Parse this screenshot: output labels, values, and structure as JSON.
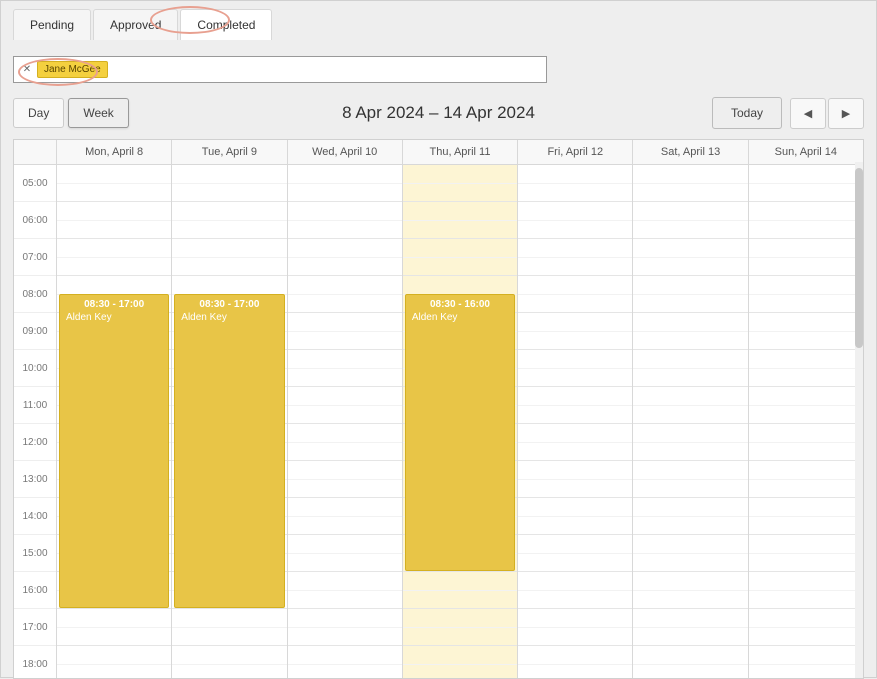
{
  "tabs": {
    "pending": "Pending",
    "approved": "Approved",
    "completed": "Completed"
  },
  "filter": {
    "tag_value": "Jane McGee"
  },
  "view": {
    "day": "Day",
    "week": "Week"
  },
  "date_range": "8 Apr 2024 – 14 Apr 2024",
  "controls": {
    "today": "Today"
  },
  "days": [
    "Mon, April 8",
    "Tue, April 9",
    "Wed, April 10",
    "Thu, April 11",
    "Fri, April 12",
    "Sat, April 13",
    "Sun, April 14"
  ],
  "hours": [
    "05:00",
    "06:00",
    "07:00",
    "08:00",
    "09:00",
    "10:00",
    "11:00",
    "12:00",
    "13:00",
    "14:00",
    "15:00",
    "16:00",
    "17:00",
    "18:00"
  ],
  "events": {
    "mon": {
      "time": "08:30 - 17:00",
      "title": "Alden Key"
    },
    "tue": {
      "time": "08:30 - 17:00",
      "title": "Alden Key"
    },
    "thu": {
      "time": "08:30 - 16:00",
      "title": "Alden Key"
    }
  },
  "colors": {
    "event_bg": "#e8c547",
    "highlight_bg": "#fdf5d4",
    "annotation": "#e8a090"
  }
}
